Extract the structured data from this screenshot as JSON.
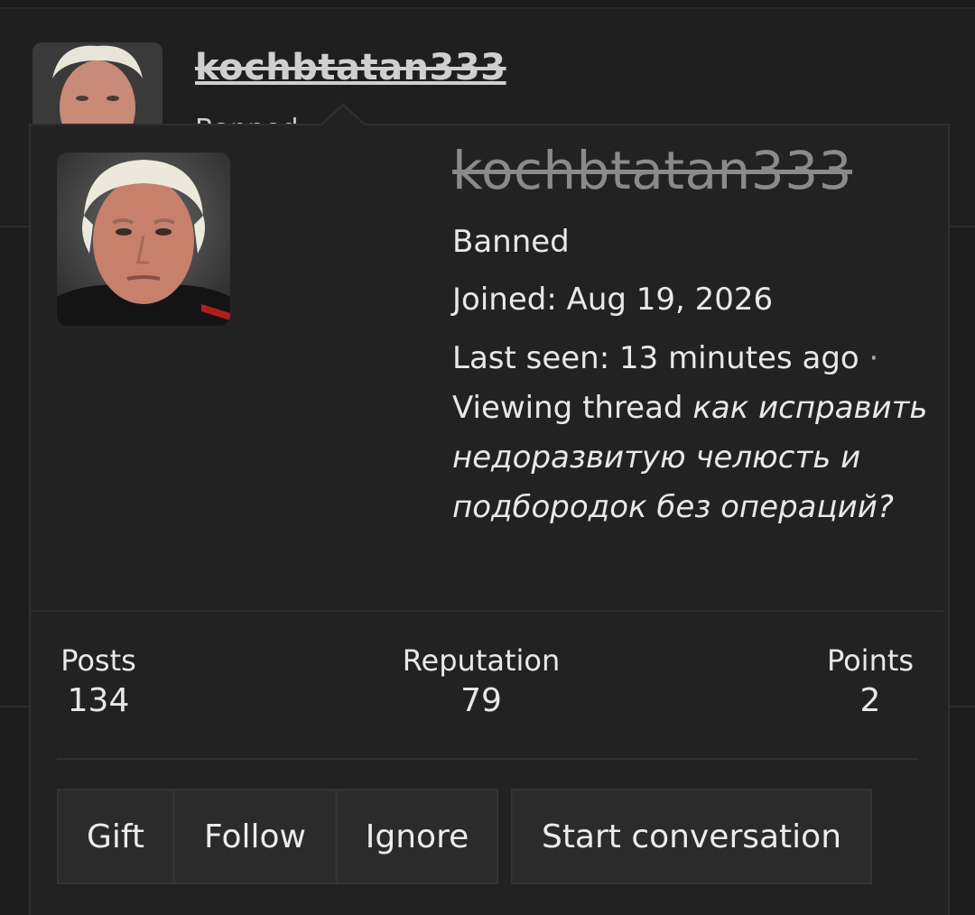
{
  "background_post": {
    "username": "kochbtatan333",
    "role_peek": "Banned"
  },
  "profile": {
    "username": "kochbtatan333",
    "role": "Banned",
    "joined": "Joined: Aug 19, 2026",
    "last_seen": "Last seen: 13 minutes ago",
    "separator": "·",
    "viewing_prefix": "Viewing thread",
    "thread_title": "как исправить недоразвитую челюсть и подбородок без операций?"
  },
  "stats": {
    "posts_label": "Posts",
    "posts_value": "134",
    "reputation_label": "Reputation",
    "reputation_value": "79",
    "points_label": "Points",
    "points_value": "2"
  },
  "actions": {
    "gift": "Gift",
    "follow": "Follow",
    "ignore": "Ignore",
    "start_conversation": "Start conversation"
  },
  "colors": {
    "background": "#1c1c1c",
    "popup": "#222222",
    "button": "#2b2b2b",
    "username_strike": "#8a8a8a"
  },
  "icons": {
    "avatar": "avatar-portrait"
  }
}
